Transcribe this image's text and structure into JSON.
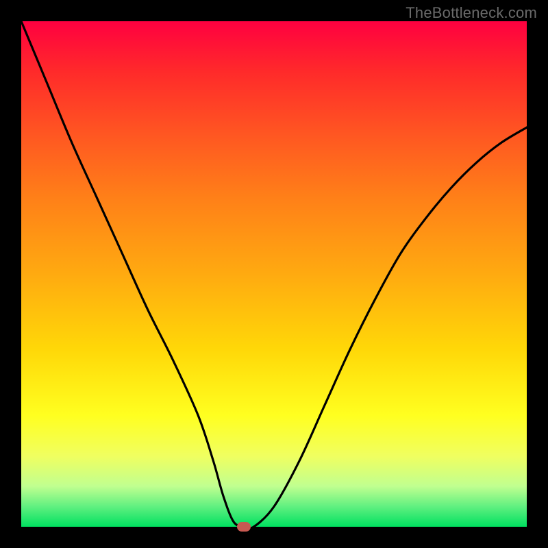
{
  "watermark": {
    "text": "TheBottleneck.com"
  },
  "colors": {
    "background": "#000000",
    "curve": "#000000",
    "marker": "#c95a52"
  },
  "chart_data": {
    "type": "line",
    "title": "",
    "xlabel": "",
    "ylabel": "",
    "xlim": [
      0,
      100
    ],
    "ylim": [
      0,
      100
    ],
    "grid": false,
    "legend": false,
    "series": [
      {
        "name": "curve",
        "x": [
          0,
          5,
          10,
          15,
          20,
          25,
          30,
          35,
          38,
          40,
          42,
          44,
          46,
          50,
          55,
          60,
          65,
          70,
          75,
          80,
          85,
          90,
          95,
          100
        ],
        "values": [
          100,
          88,
          76,
          65,
          54,
          43,
          33,
          22,
          13,
          6,
          1,
          0,
          0,
          4,
          13,
          24,
          35,
          45,
          54,
          61,
          67,
          72,
          76,
          79
        ]
      }
    ],
    "marker": {
      "x": 44,
      "y": 0
    }
  }
}
